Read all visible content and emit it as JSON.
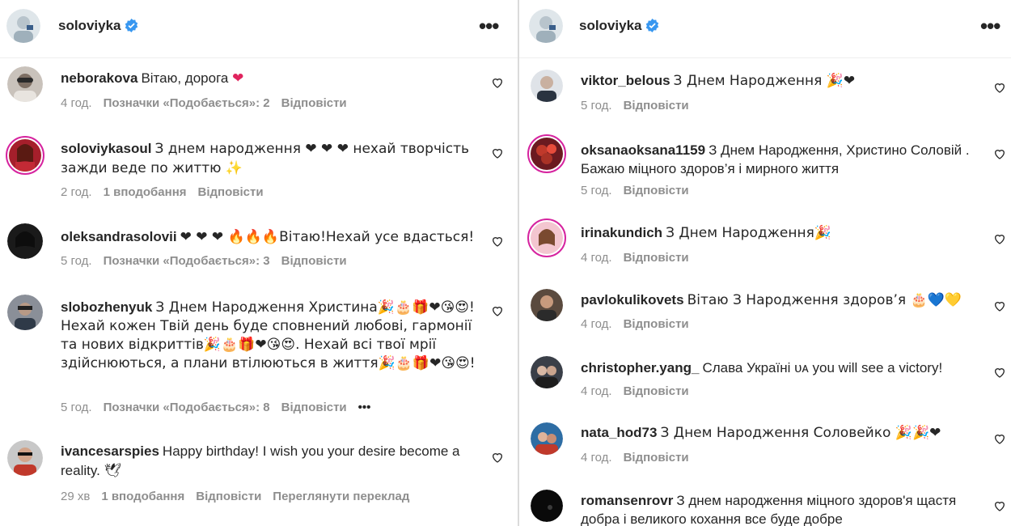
{
  "left_panel": {
    "header": {
      "username": "soloviyka",
      "more_label": "•••"
    },
    "comments": [
      {
        "user": "neborakova",
        "text": "Вітаю, дорога",
        "emoji": "❤",
        "time": "4 год.",
        "likes": "Позначки «Подобається»: 2",
        "reply": "Відповісти"
      },
      {
        "user": "soloviykasoul",
        "text": "З днем народження ❤ ❤ ❤  нехай творчість зажди веде по життю ✨",
        "time": "2 год.",
        "likes": "1 вподобання",
        "reply": "Відповісти"
      },
      {
        "user": "oleksandrasolovii",
        "text": "❤ ❤ ❤ 🔥🔥🔥Вітаю!Нехай усе вдасться!",
        "time": "5 год.",
        "likes": "Позначки «Подобається»: 3",
        "reply": "Відповісти"
      },
      {
        "user": "slobozhenyuk",
        "text": "З Днем Народження Христина🎉🎂🎁❤😘😍! Нехай кожен Твій день буде сповнений любові, гармонії та нових відкриттів🎉🎂🎁❤😘😍. Нехай всі твої мрії здійснюються, а плани втілюються в життя🎉🎂🎁❤😘😍!",
        "time": "5 год.",
        "likes": "Позначки «Подобається»: 8",
        "reply": "Відповісти",
        "more": "•••"
      },
      {
        "user": "ivancesarspies",
        "text": "Happy birthday! I wish you your desire become a reality. 🕊",
        "time": "29 хв",
        "likes": "1 вподобання",
        "reply": "Відповісти",
        "translate": "Переглянути переклад"
      }
    ]
  },
  "right_panel": {
    "header": {
      "username": "soloviyka",
      "more_label": "•••"
    },
    "comments": [
      {
        "user": "viktor_belous",
        "text": "З Днем Народження 🎉❤",
        "time": "5 год.",
        "reply": "Відповісти"
      },
      {
        "user": "oksanaoksana1159",
        "text": "З Днем Народження, Христино Соловій . Бажаю міцного здоров’я і мирного життя",
        "time": "5 год.",
        "reply": "Відповісти"
      },
      {
        "user": "irinakundich",
        "text": "З Днем Народження🎉",
        "time": "4 год.",
        "reply": "Відповісти"
      },
      {
        "user": "pavlokulikovets",
        "text": "Вітаю З Народження здоров’я 🎂💙💛",
        "time": "4 год.",
        "reply": "Відповісти"
      },
      {
        "user": "christopher.yang_",
        "text": "Слава Україні ᴜᴀ you will see a victory!",
        "time": "4 год.",
        "reply": "Відповісти"
      },
      {
        "user": "nata_hod73",
        "text": "З Днем Народження Соловейко 🎉🎉❤",
        "time": "4 год.",
        "reply": "Відповісти"
      },
      {
        "user": "romansenrovr",
        "text": "З днем народження міцного здоров'я щастя добра і великого кохання все буде добре",
        "time": "",
        "reply": ""
      }
    ]
  },
  "colors": {
    "verified": "#3897f0",
    "meta": "#8e8e8e",
    "text": "#262626",
    "heart": "#e0245e"
  },
  "icons": [
    "verified-icon",
    "more-icon",
    "like-heart-icon",
    "avatar"
  ]
}
